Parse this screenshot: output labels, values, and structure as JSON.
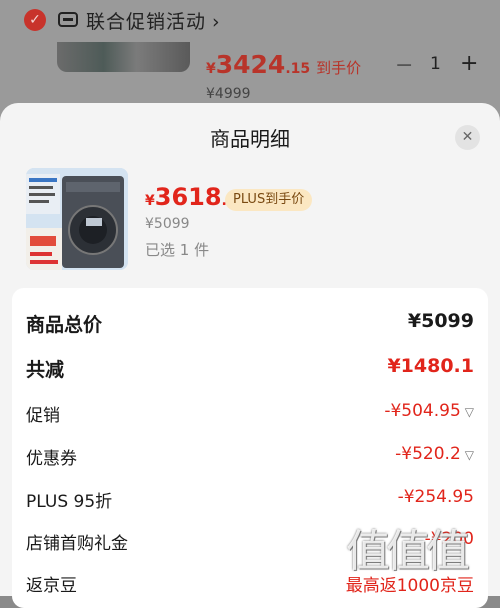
{
  "background": {
    "store_title": "联合促销活动",
    "store_chevron": "›",
    "checked_icon": "✓",
    "price_symbol": "¥",
    "price_int": "3424",
    "price_dec": ".15",
    "price_tag": "到手价",
    "original_price": "¥4999",
    "qty_minus": "−",
    "qty_value": "1",
    "qty_plus": "+"
  },
  "sheet": {
    "title": "商品明细",
    "close_icon": "✕"
  },
  "product": {
    "price_symbol": "¥",
    "price_int": "3618",
    "price_dec": ".9",
    "plus_badge": "PLUS到手价",
    "original_price": "¥5099",
    "selected": "已选 1 件"
  },
  "breakdown": [
    {
      "label": "商品总价",
      "value": "¥5099",
      "bold": true,
      "color": "dark",
      "chevron": false
    },
    {
      "label": "共减",
      "value": "¥1480.1",
      "bold": true,
      "color": "red",
      "chevron": false
    },
    {
      "label": "促销",
      "value": "-¥504.95",
      "bold": false,
      "color": "red",
      "chevron": true
    },
    {
      "label": "优惠券",
      "value": "-¥520.2",
      "bold": false,
      "color": "red",
      "chevron": true
    },
    {
      "label": "PLUS 95折",
      "value": "-¥254.95",
      "bold": false,
      "color": "red",
      "chevron": false
    },
    {
      "label": "店铺首购礼金",
      "value": "-¥200",
      "bold": false,
      "color": "red",
      "chevron": false
    },
    {
      "label": "返京豆",
      "value": "最高返1000京豆",
      "bold": false,
      "color": "red",
      "chevron": false
    }
  ],
  "watermark": "值值值",
  "colors": {
    "accent_red": "#e1251b",
    "plus_badge_bg": "#fbe7c2"
  }
}
